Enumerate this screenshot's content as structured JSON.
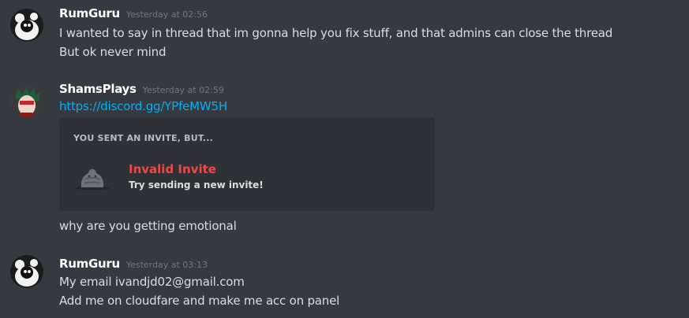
{
  "messages": [
    {
      "username": "RumGuru",
      "timestamp": "Yesterday at 02:56",
      "lines": [
        "I wanted to say in thread that im gonna  help you fix stuff, and that admins can close the thread",
        "But ok never mind"
      ]
    },
    {
      "username": "ShamsPlays",
      "timestamp": "Yesterday at 02:59",
      "link": "https://discord.gg/YPfeMW5H",
      "embed": {
        "header": "YOU SENT AN INVITE, BUT...",
        "title": "Invalid Invite",
        "subtitle": "Try sending a new invite!"
      },
      "followup": "why are you getting emotional"
    },
    {
      "username": "RumGuru",
      "timestamp": "Yesterday at 03:13",
      "lines": [
        "My email ivandjd02@gmail.com",
        "Add me on cloudfare and make me acc on panel"
      ]
    }
  ],
  "colors": {
    "background": "#36393f",
    "embed_background": "#2f3136",
    "link": "#00b0f4",
    "invalid": "#f04747"
  }
}
